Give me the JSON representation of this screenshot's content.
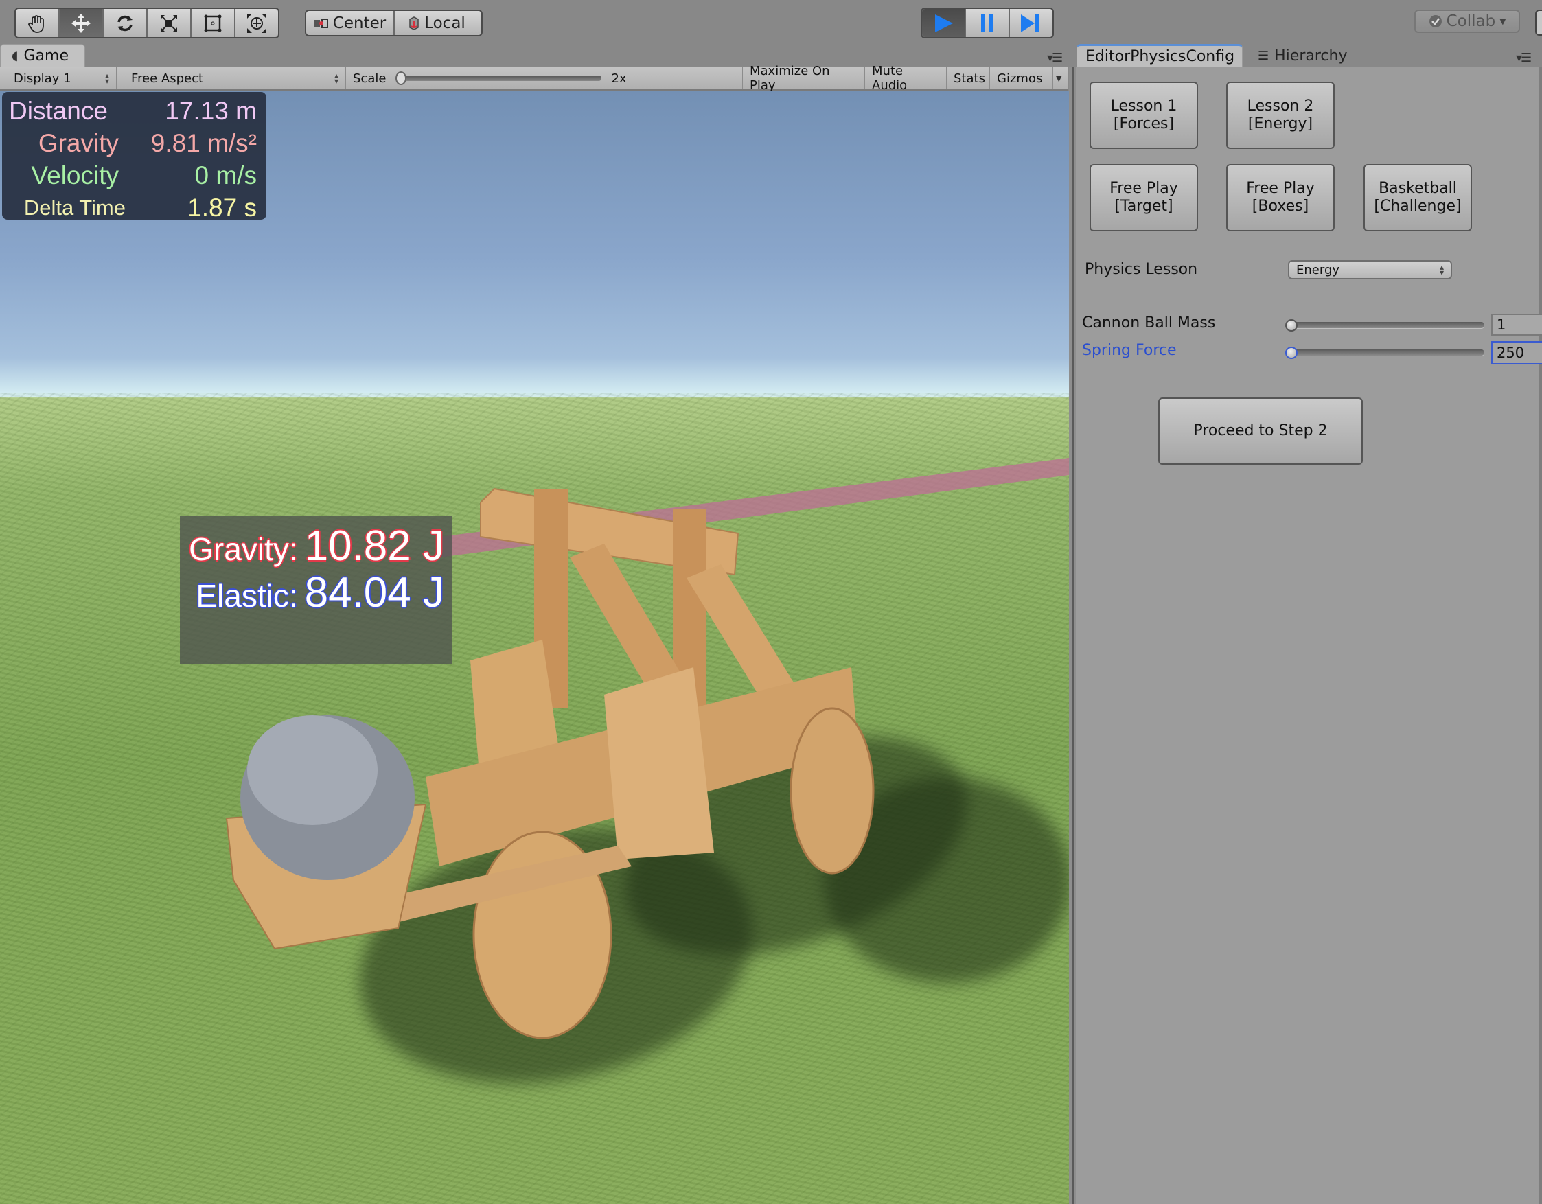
{
  "toolbar": {
    "tools": [
      {
        "name": "hand-tool",
        "icon": "hand-icon",
        "active": false
      },
      {
        "name": "move-tool",
        "icon": "move-arrows-icon",
        "active": true
      },
      {
        "name": "rotate-tool",
        "icon": "rotate-icon",
        "active": false
      },
      {
        "name": "scale-tool",
        "icon": "scale-icon",
        "active": false
      },
      {
        "name": "rect-tool",
        "icon": "rect-transform-icon",
        "active": false
      },
      {
        "name": "transform-tool",
        "icon": "transform-icon",
        "active": false
      }
    ],
    "pivot_label": "Center",
    "space_label": "Local",
    "play_controls": {
      "play_active": true
    },
    "collab_label": "Collab"
  },
  "game_panel": {
    "tab_label": "Game",
    "display": "Display 1",
    "aspect": "Free Aspect",
    "scale_label": "Scale",
    "scale_value": "2x",
    "maximize_on_play": "Maximize On Play",
    "mute_audio": "Mute Audio",
    "stats": "Stats",
    "gizmos": "Gizmos"
  },
  "hud": {
    "rows": [
      {
        "label": "Distance",
        "value": "17.13 m",
        "color": "#f0c8f4"
      },
      {
        "label": "Gravity",
        "value": "9.81 m/s²",
        "color": "#f4a8a8"
      },
      {
        "label": "Velocity",
        "value": "0 m/s",
        "color": "#a8f0a4"
      },
      {
        "label": "Delta Time",
        "value": "1.87 s",
        "color": "#f2f0b0"
      }
    ]
  },
  "energy_panel": {
    "gravity_label": "Gravity:",
    "gravity_value": "10.82 J",
    "elastic_label": "Elastic:",
    "elastic_value": "84.04 J"
  },
  "inspector": {
    "tabs": [
      {
        "label": "EditorPhysicsConfig",
        "active": true
      },
      {
        "label": "Hierarchy",
        "active": false
      }
    ],
    "lesson_buttons": [
      {
        "line1": "Lesson 1",
        "line2": "[Forces]"
      },
      {
        "line1": "Lesson 2",
        "line2": "[Energy]"
      },
      {
        "line1": "Free Play",
        "line2": "[Target]"
      },
      {
        "line1": "Free Play",
        "line2": "[Boxes]"
      },
      {
        "line1": "Basketball",
        "line2": "[Challenge]"
      }
    ],
    "physics_lesson_label": "Physics Lesson",
    "physics_lesson_value": "Energy",
    "cannon_ball_mass": {
      "label": "Cannon Ball Mass",
      "value": "1",
      "slider_fraction": 0.0
    },
    "spring_force": {
      "label": "Spring Force",
      "value": "250",
      "slider_fraction": 0.0,
      "focused": true
    },
    "proceed_button": "Proceed to Step 2"
  },
  "colors": {
    "accent_blue": "#2a4ecf",
    "play_blue": "#1e7cf0",
    "panel_gray": "#9c9c9c"
  }
}
